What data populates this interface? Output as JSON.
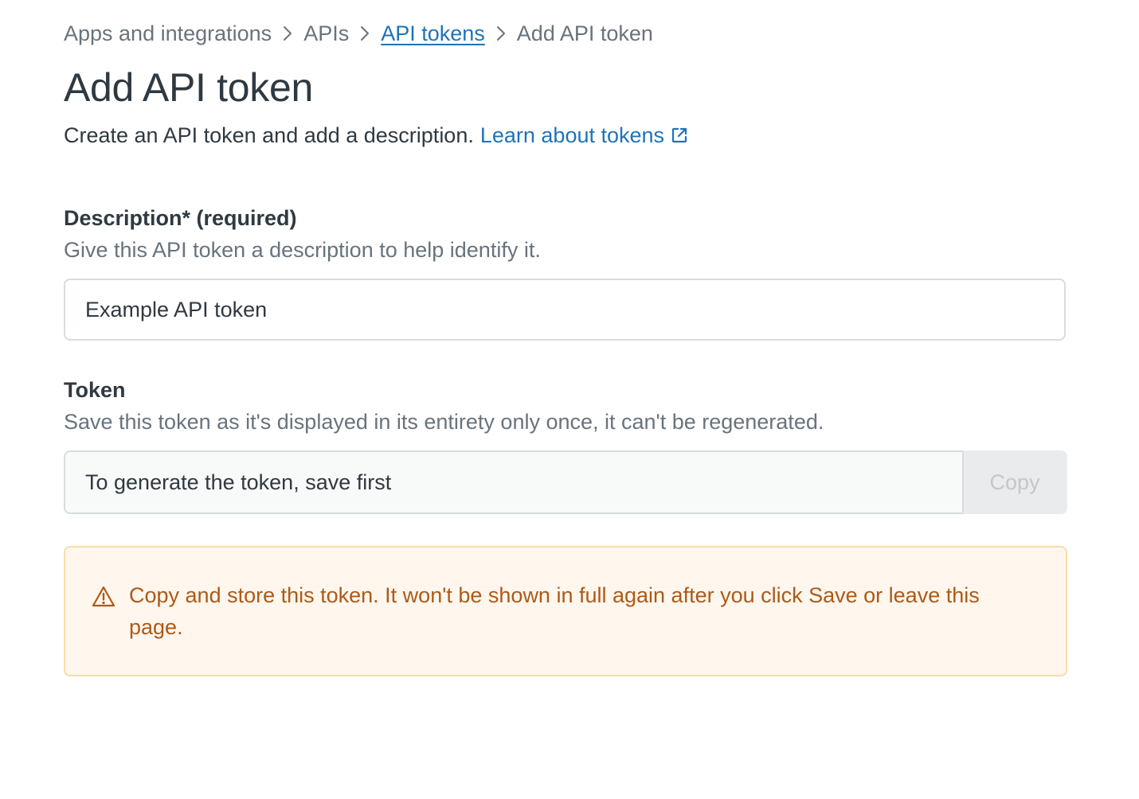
{
  "breadcrumb": {
    "items": [
      {
        "label": "Apps and integrations"
      },
      {
        "label": "APIs"
      },
      {
        "label": "API tokens"
      },
      {
        "label": "Add API token"
      }
    ]
  },
  "page": {
    "title": "Add API token",
    "description": "Create an API token and add a description.",
    "learn_link": "Learn about tokens"
  },
  "description_field": {
    "label": "Description* (required)",
    "hint": "Give this API token a description to help identify it.",
    "value": "Example API token"
  },
  "token_field": {
    "label": "Token",
    "hint": "Save this token as it's displayed in its entirety only once, it can't be regenerated.",
    "placeholder": "To generate the token, save first",
    "copy_label": "Copy"
  },
  "alert": {
    "icon": "warning-triangle-icon",
    "text": "Copy and store this token. It won't be shown in full again after you click Save or leave this page."
  },
  "colors": {
    "link": "#1f73b7",
    "text": "#2f3941",
    "muted": "#68737d",
    "warning_text": "#ad5918",
    "warning_bg": "#fff7ed",
    "warning_border": "#fcdba9"
  }
}
